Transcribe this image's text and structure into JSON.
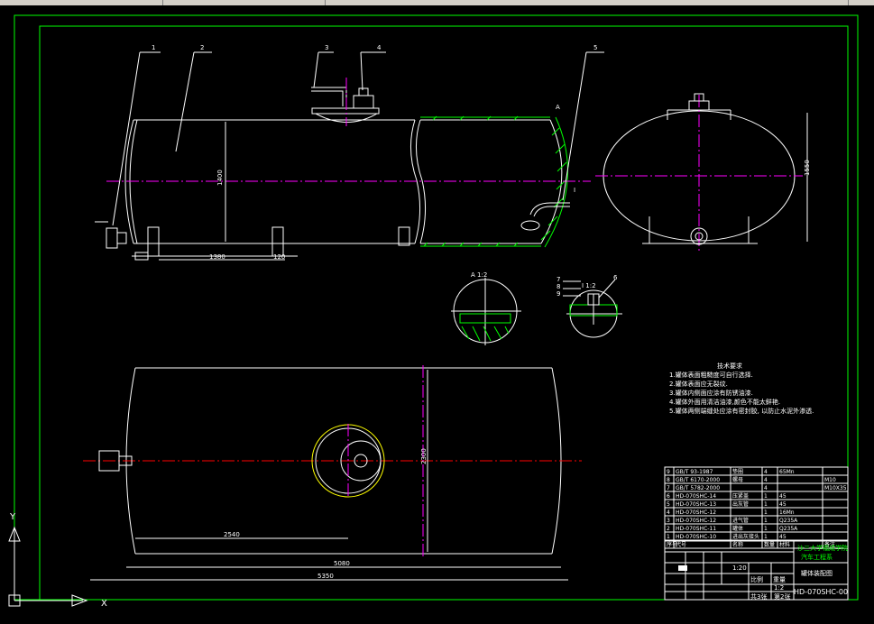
{
  "balloons": [
    "1",
    "2",
    "3",
    "4",
    "5",
    "6",
    "7",
    "8",
    "9"
  ],
  "dims": {
    "d1400": "1400",
    "d1380": "1380",
    "d120": "120",
    "d1550": "1550",
    "d1900": "1900",
    "d2300": "2300",
    "d2540": "2540",
    "d5080": "5080",
    "d5350": "5350"
  },
  "details": {
    "a_label": "A 1:2",
    "b_label": "I 1:2"
  },
  "notes": {
    "title": "技术要求",
    "items": [
      "1.罐体表面粗糙度可自行选择.",
      "2.罐体表面应无裂纹.",
      "3.罐体内侧面应涂有防锈油漆.",
      "4.罐体外面用清洁油漆,颜色不能太鲜艳.",
      "5.罐体两侧端缝处应涂有密封胶, 以防止水泥外渗透."
    ]
  },
  "bom": [
    {
      "no": "9",
      "code": "GB/T 93-1987",
      "name": "垫圈",
      "qty": "4",
      "mat": "65Mn",
      "note": ""
    },
    {
      "no": "8",
      "code": "GB/T 6170-2000",
      "name": "螺母",
      "qty": "4",
      "mat": "",
      "note": "M10"
    },
    {
      "no": "7",
      "code": "GB/T 5782-2000",
      "name": "",
      "qty": "4",
      "mat": "",
      "note": "M10X35"
    },
    {
      "no": "6",
      "code": "HD-070SHC-14",
      "name": "压紧盖",
      "qty": "1",
      "mat": "45",
      "note": ""
    },
    {
      "no": "5",
      "code": "HD-070SHC-13",
      "name": "出灰管",
      "qty": "1",
      "mat": "45",
      "note": ""
    },
    {
      "no": "4",
      "code": "HD-070SHC-12",
      "name": "",
      "qty": "1",
      "mat": "16Mn",
      "note": ""
    },
    {
      "no": "3",
      "code": "HD-070SHC-12",
      "name": "进气管",
      "qty": "1",
      "mat": "Q235A",
      "note": ""
    },
    {
      "no": "2",
      "code": "HD-070SHC-11",
      "name": "罐体",
      "qty": "1",
      "mat": "Q235A",
      "note": ""
    },
    {
      "no": "1",
      "code": "HD-070SHC-10",
      "name": "进出灰接头",
      "qty": "1",
      "mat": "45",
      "note": ""
    }
  ],
  "bom_header": [
    "序号",
    "代号",
    "名称",
    "数量",
    "材料",
    "备注"
  ],
  "title_block": {
    "school": "沙三大学福成学院",
    "dept": "汽车工程系",
    "drawing_name": "罐体装配图",
    "drawing_no": "HD-070SHC-00",
    "sheets": "共3张",
    "sheet": "第2张",
    "scale_label": "比例",
    "weight_label": "重量",
    "scale": "1:2",
    "ratio_label": "1:20"
  },
  "colors": {
    "frame": "#00ff00",
    "object": "#ffffff",
    "center": "#ff00ff",
    "axis": "#ff0000",
    "text": "#ffff00"
  },
  "ucs_icon": "ucs-axis-icon"
}
